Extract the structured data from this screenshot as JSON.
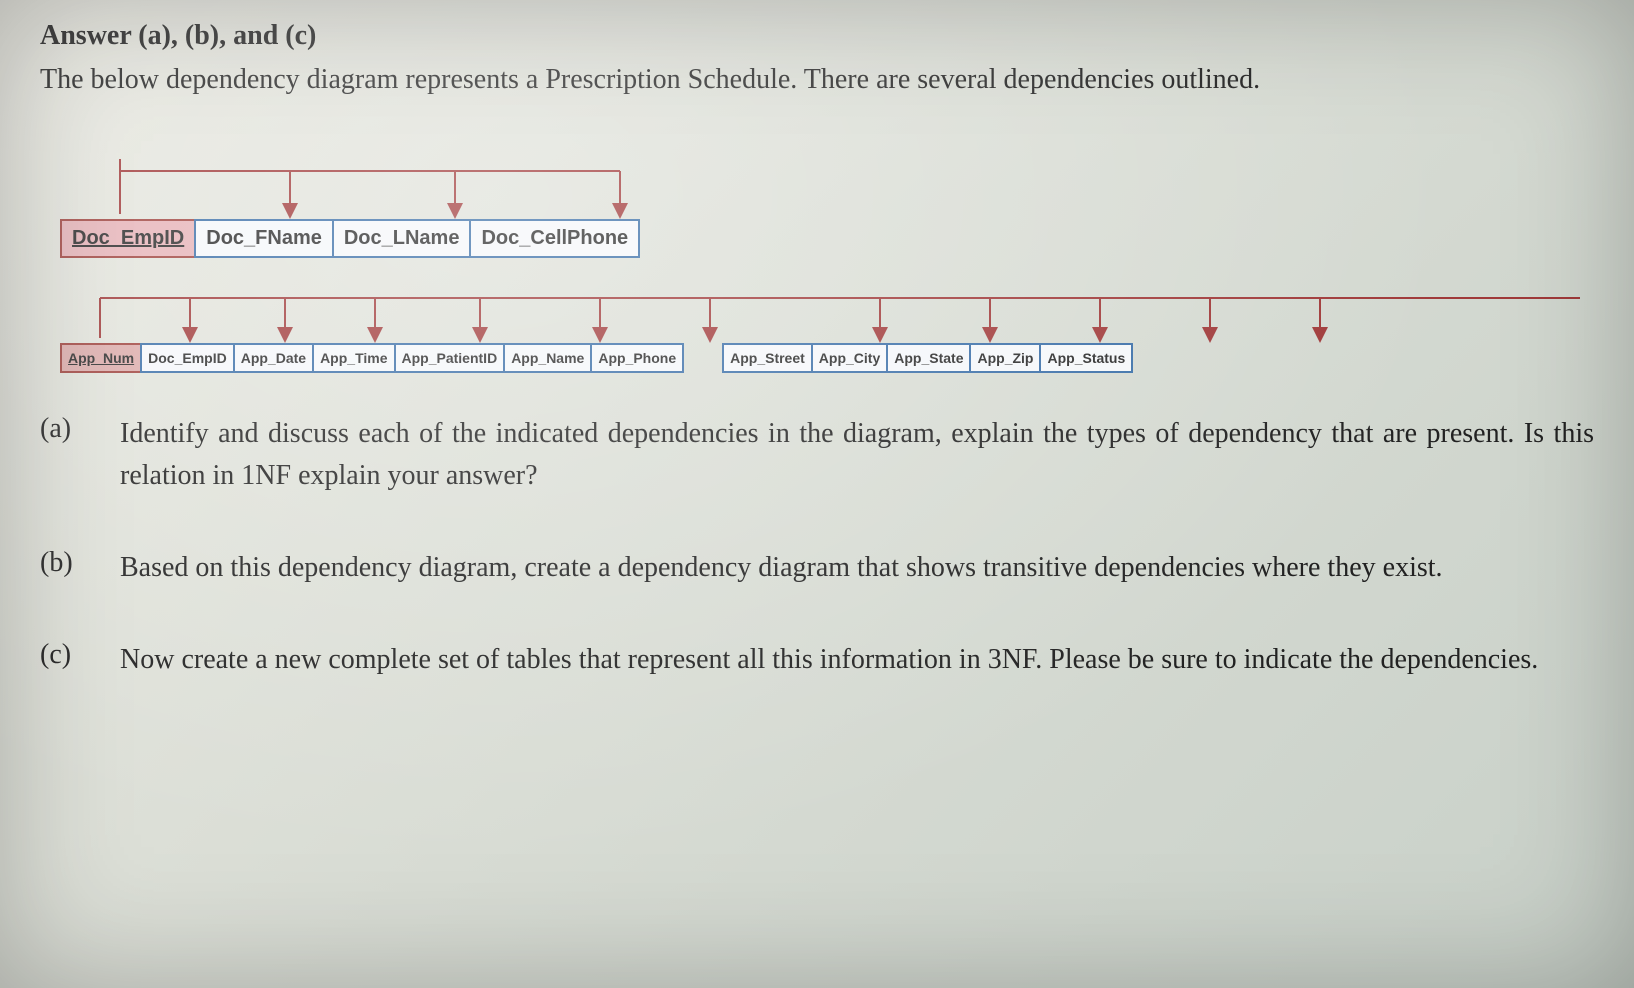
{
  "heading": "Answer (a), (b), and (c)",
  "intro": "The below dependency diagram represents a Prescription Schedule. There are several dependencies outlined.",
  "diagram": {
    "row1": {
      "pk": "Doc_EmpID",
      "attrs": [
        "Doc_FName",
        "Doc_LName",
        "Doc_CellPhone"
      ]
    },
    "row2": {
      "pk": "App_Num",
      "group1": [
        "Doc_EmpID",
        "App_Date",
        "App_Time",
        "App_PatientID",
        "App_Name",
        "App_Phone"
      ],
      "group2": [
        "App_Street",
        "App_City",
        "App_State",
        "App_Zip",
        "App_Status"
      ]
    }
  },
  "questions": {
    "a": {
      "label": "(a)",
      "text": "Identify and discuss each of the indicated dependencies in the diagram, explain the types of dependency that are present. Is this relation in 1NF explain your answer?"
    },
    "b": {
      "label": "(b)",
      "text": "Based on this dependency diagram, create a dependency diagram that shows transitive dependencies where they exist."
    },
    "c": {
      "label": "(c)",
      "text": "Now create a new complete set of tables that represent all this information in 3NF. Please be sure to indicate the dependencies."
    }
  }
}
